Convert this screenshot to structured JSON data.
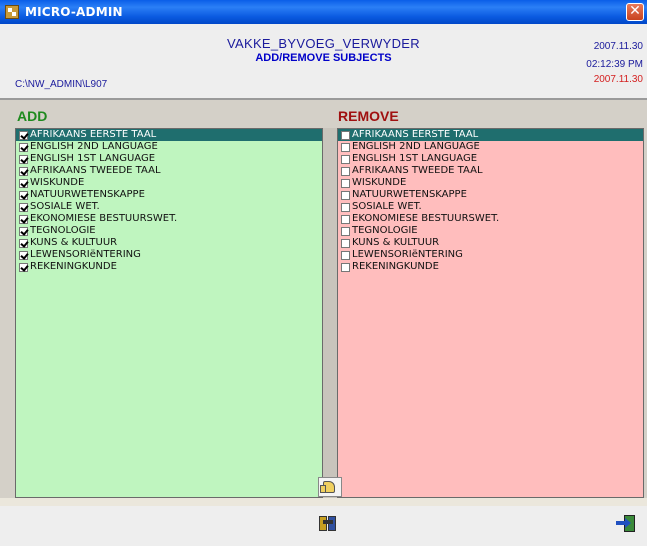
{
  "window": {
    "title": "MICRO-ADMIN",
    "close_glyph": "✕",
    "app_icon": "micro-admin-app-icon"
  },
  "header": {
    "title": "VAKKE_BYVOEG_VERWYDER",
    "subtitle": "ADD/REMOVE SUBJECTS",
    "path": "C:\\NW_ADMIN\\L907",
    "date_top": "2007.11.30",
    "time": "02:12:39 PM",
    "date_bottom": "2007.11.30"
  },
  "add_panel": {
    "label": "ADD",
    "items": [
      {
        "label": "AFRIKAANS EERSTE TAAL",
        "checked": true,
        "selected": true
      },
      {
        "label": "ENGLISH 2ND LANGUAGE",
        "checked": true,
        "selected": false
      },
      {
        "label": "ENGLISH 1ST LANGUAGE",
        "checked": true,
        "selected": false
      },
      {
        "label": "AFRIKAANS TWEEDE TAAL",
        "checked": true,
        "selected": false
      },
      {
        "label": "WISKUNDE",
        "checked": true,
        "selected": false
      },
      {
        "label": "NATUURWETENSKAPPE",
        "checked": true,
        "selected": false
      },
      {
        "label": "SOSIALE WET.",
        "checked": true,
        "selected": false
      },
      {
        "label": "EKONOMIESE BESTUURSWET.",
        "checked": true,
        "selected": false
      },
      {
        "label": "TEGNOLOGIE",
        "checked": true,
        "selected": false
      },
      {
        "label": "KUNS & KULTUUR",
        "checked": true,
        "selected": false
      },
      {
        "label": "LEWENSORIëNTERING",
        "checked": true,
        "selected": false
      },
      {
        "label": "REKENINGKUNDE",
        "checked": true,
        "selected": false
      }
    ]
  },
  "remove_panel": {
    "label": "REMOVE",
    "items": [
      {
        "label": "AFRIKAANS EERSTE TAAL",
        "checked": false,
        "selected": true
      },
      {
        "label": "ENGLISH 2ND LANGUAGE",
        "checked": false,
        "selected": false
      },
      {
        "label": "ENGLISH 1ST LANGUAGE",
        "checked": false,
        "selected": false
      },
      {
        "label": "AFRIKAANS TWEEDE TAAL",
        "checked": false,
        "selected": false
      },
      {
        "label": "WISKUNDE",
        "checked": false,
        "selected": false
      },
      {
        "label": "NATUURWETENSKAPPE",
        "checked": false,
        "selected": false
      },
      {
        "label": "SOSIALE WET.",
        "checked": false,
        "selected": false
      },
      {
        "label": "EKONOMIESE BESTUURSWET.",
        "checked": false,
        "selected": false
      },
      {
        "label": "TEGNOLOGIE",
        "checked": false,
        "selected": false
      },
      {
        "label": "KUNS & KULTUUR",
        "checked": false,
        "selected": false
      },
      {
        "label": "LEWENSORIëNTERING",
        "checked": false,
        "selected": false
      },
      {
        "label": "REKENINGKUNDE",
        "checked": false,
        "selected": false
      }
    ]
  },
  "buttons": {
    "transfer_icon": "pointing-hand-icon",
    "tool_icon": "books-tool-icon",
    "exit_icon": "exit-door-icon"
  },
  "colors": {
    "titlebar": "#0a5ee8",
    "add_bg": "#bff5bf",
    "remove_bg": "#ffbdbd",
    "add_label": "#1e8a1e",
    "remove_label": "#a01010",
    "selected_row": "#1f6e6e"
  }
}
